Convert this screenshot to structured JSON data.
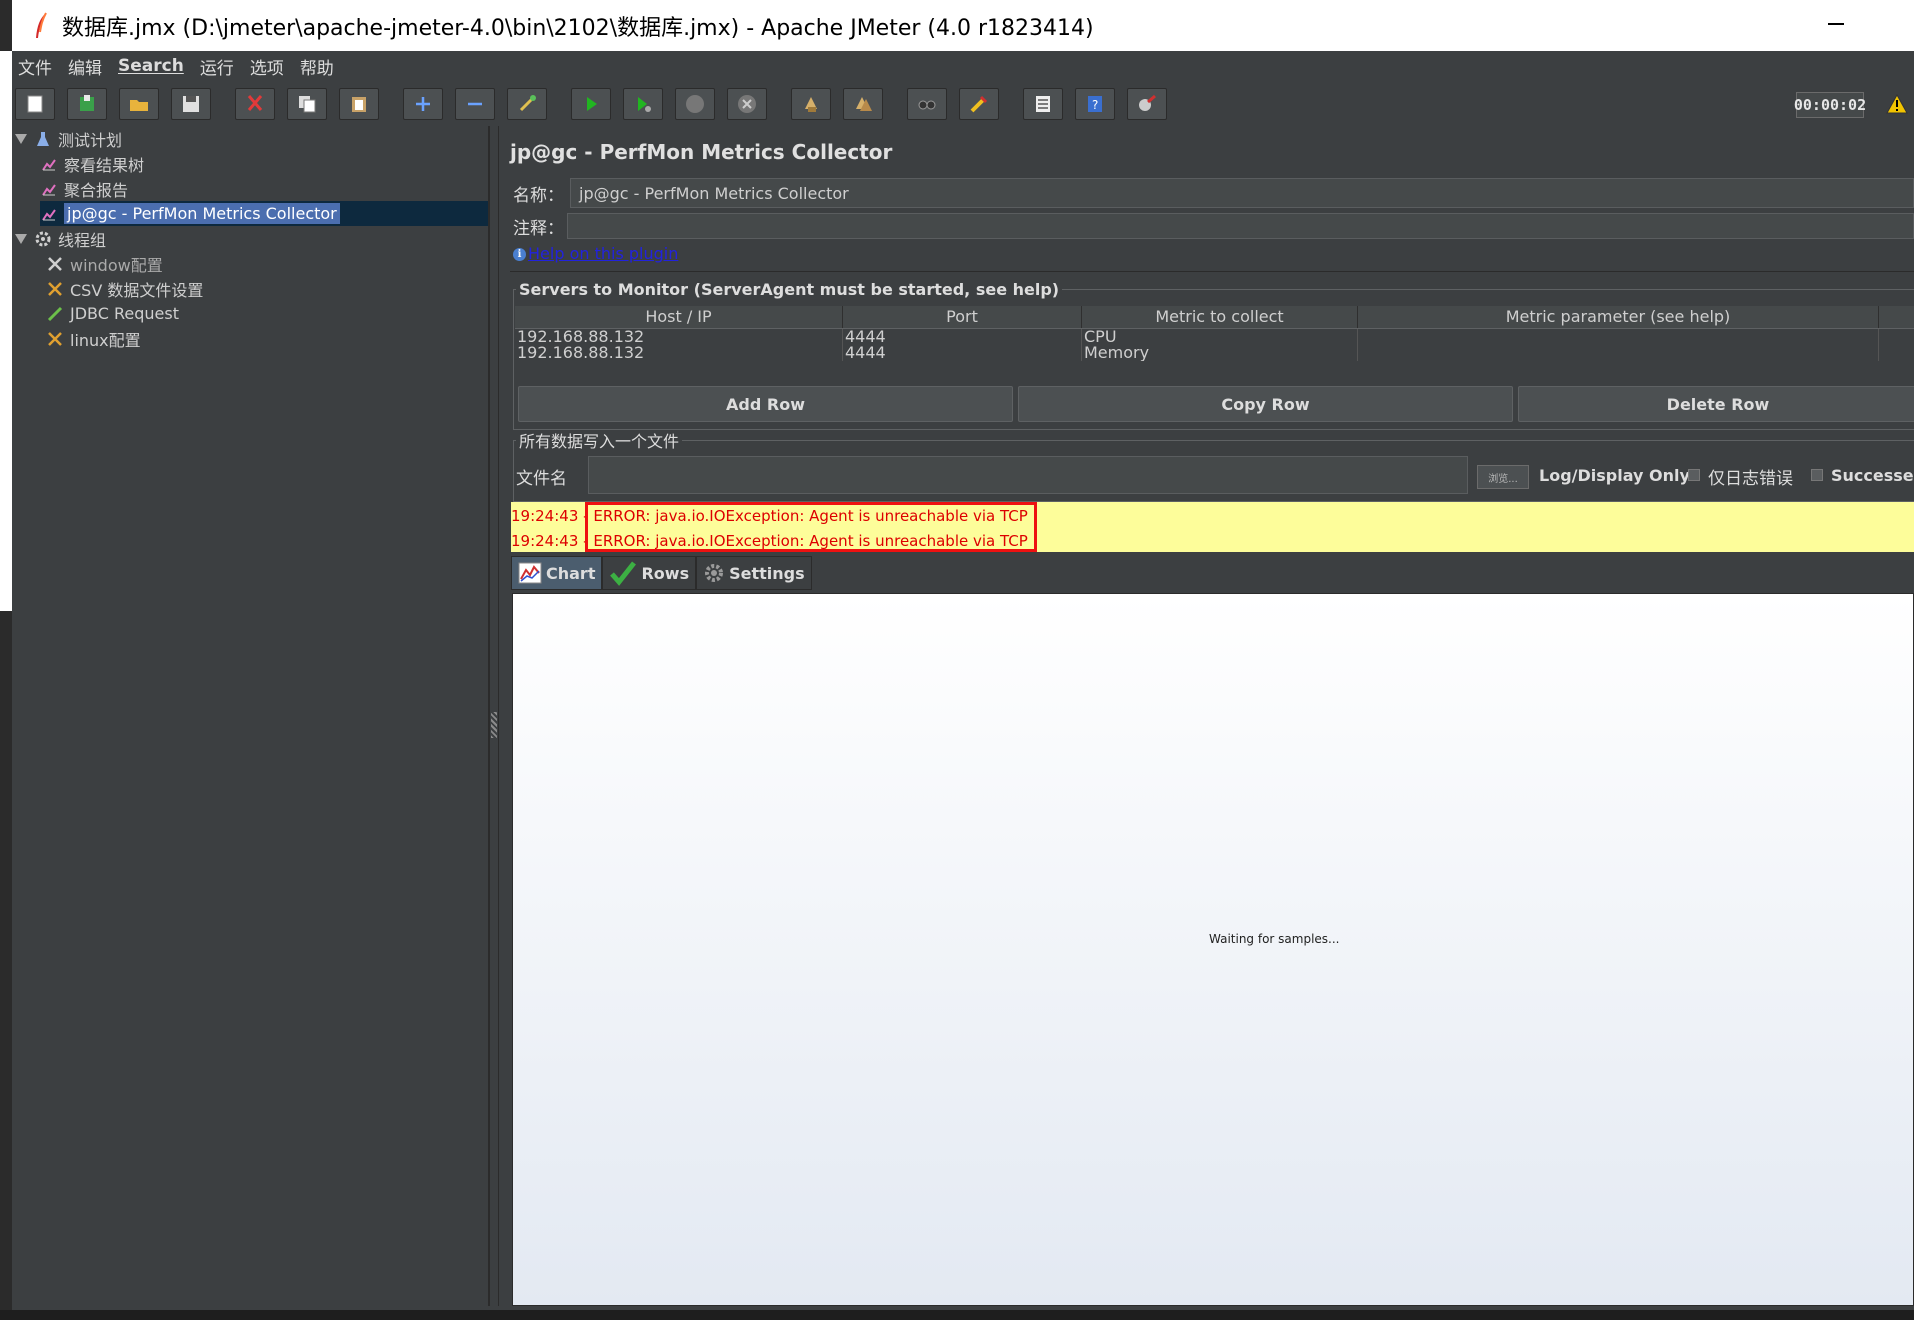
{
  "window": {
    "title": "数据库.jmx (D:\\jmeter\\apache-jmeter-4.0\\bin\\2102\\数据库.jmx) - Apache JMeter (4.0 r1823414)"
  },
  "menu": [
    "文件",
    "编辑",
    "Search",
    "运行",
    "选项",
    "帮助"
  ],
  "toolbar": {
    "icons": [
      "new-icon",
      "templates-icon",
      "open-icon",
      "save-icon",
      "cut-icon",
      "copy-icon",
      "paste-icon",
      "expand-icon",
      "collapse-icon",
      "toggle-icon",
      "start-icon",
      "start-no-pauses-icon",
      "stop-icon",
      "shutdown-icon",
      "clear-icon",
      "clear-all-icon",
      "search-icon",
      "reset-search-icon",
      "function-helper-icon",
      "help-icon",
      "log-viewer-icon"
    ],
    "timer": "00:00:02",
    "warning_icon": "warning-icon"
  },
  "tree": {
    "items": [
      {
        "label": "测试计划",
        "icon": "test-plan-icon"
      },
      {
        "label": "察看结果树",
        "icon": "listener-icon"
      },
      {
        "label": "聚合报告",
        "icon": "listener-icon"
      },
      {
        "label": "jp@gc - PerfMon Metrics Collector",
        "icon": "listener-icon"
      },
      {
        "label": "线程组",
        "icon": "thread-group-icon"
      },
      {
        "label": "window配置",
        "icon": "config-icon"
      },
      {
        "label": "CSV 数据文件设置",
        "icon": "config-icon"
      },
      {
        "label": "JDBC Request",
        "icon": "sampler-icon"
      },
      {
        "label": "linux配置",
        "icon": "config-icon"
      }
    ]
  },
  "panel": {
    "title": "jp@gc - PerfMon Metrics Collector",
    "name_label": "名称：",
    "name_value": "jp@gc - PerfMon Metrics Collector",
    "comment_label": "注释：",
    "help_link": "Help on this plugin",
    "servers_legend": "Servers to Monitor (ServerAgent must be started, see help)",
    "columns": [
      "Host / IP",
      "Port",
      "Metric to collect",
      "Metric parameter (see help)"
    ],
    "rows": [
      [
        "192.168.88.132",
        "4444",
        "CPU",
        ""
      ],
      [
        "192.168.88.132",
        "4444",
        "Memory",
        ""
      ]
    ],
    "buttons": {
      "add": "Add Row",
      "copy": "Copy Row",
      "delete": "Delete Row"
    },
    "file_legend": "所有数据写入一个文件",
    "file_label": "文件名",
    "browse_label": "浏览...",
    "log_display": "Log/Display Only:",
    "errors_only": "仅日志错误",
    "successes": "Successes",
    "errors": [
      {
        "time": "19:24:43 -",
        "text": "ERROR: java.io.IOException: Agent is unreachable via TCP"
      },
      {
        "time": "19:24:43 -",
        "text": "ERROR: java.io.IOException: Agent is unreachable via TCP"
      }
    ],
    "tabs": [
      "Chart",
      "Rows",
      "Settings"
    ],
    "chart_placeholder": "Waiting for samples..."
  },
  "colors": {
    "error_text": "#dd0000",
    "error_bg": "#fdfd9a",
    "selection": "#4b6eaf"
  }
}
